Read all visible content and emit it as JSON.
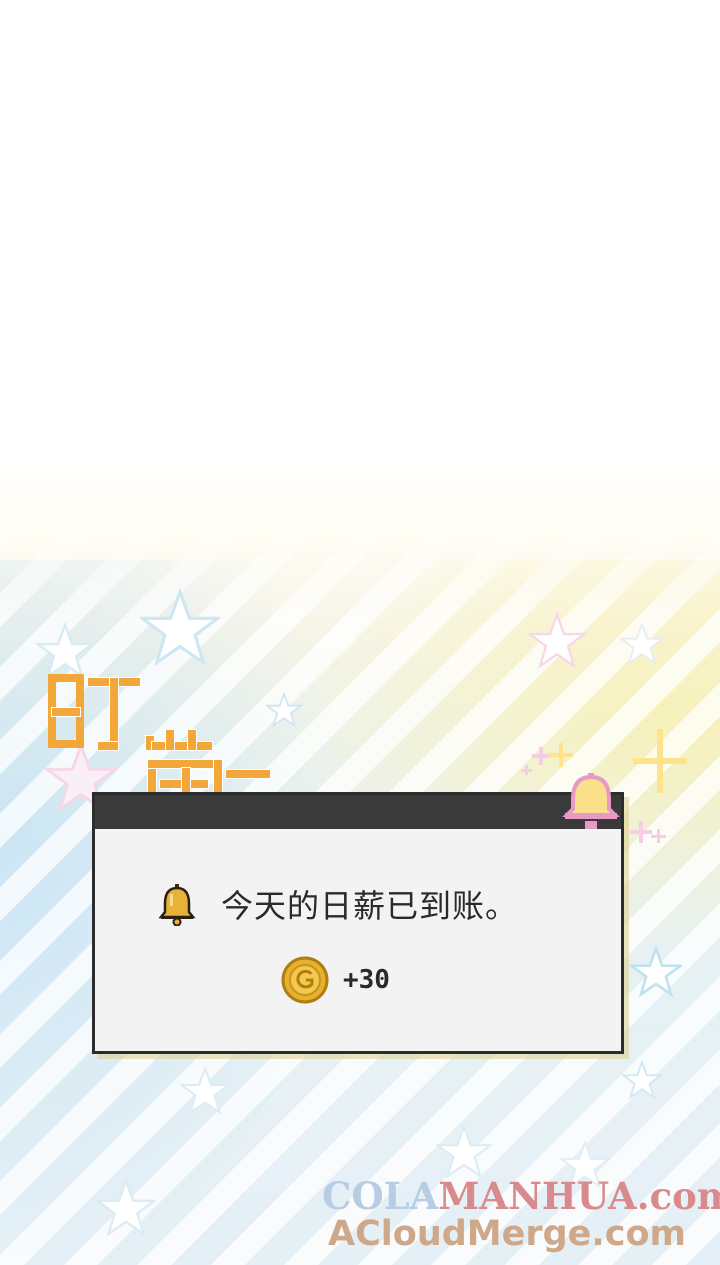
{
  "sfx": {
    "text": "叮咚~"
  },
  "notification": {
    "message": "今天的日薪已到账。",
    "reward": "+30",
    "icons": {
      "message_icon": "bell-icon",
      "reward_icon": "gold-coin-icon",
      "deco_icon": "pink-bell-icon"
    }
  },
  "watermark": {
    "line1_part1": "COLA",
    "line1_part2": "MANHUA.com",
    "line2": "ACloudMerge.com"
  },
  "colors": {
    "sfx_orange": "#f3a63a",
    "titlebar": "#3a3a3a",
    "dialog_bg": "#f3f3f3",
    "coin_gold": "#e6b22e",
    "bell_gold": "#e8b13a",
    "deco_pink": "#f2b3d6"
  }
}
